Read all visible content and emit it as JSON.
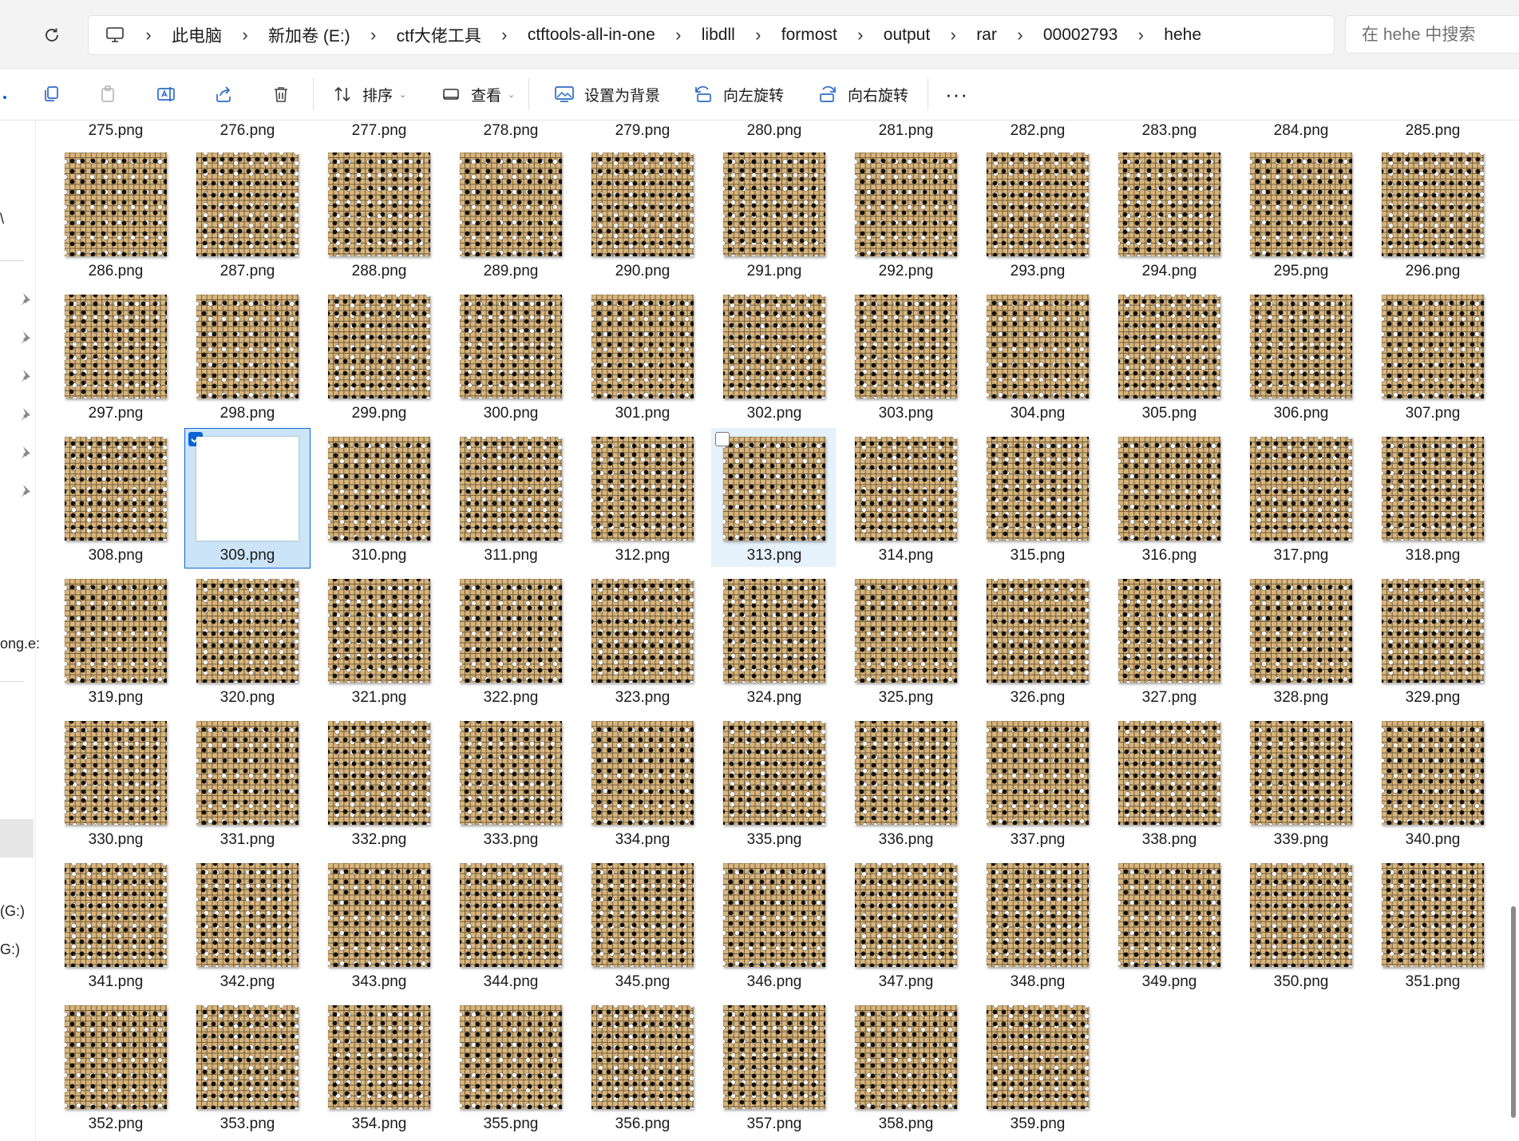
{
  "address": {
    "crumbs": [
      "此电脑",
      "新加卷 (E:)",
      "ctf大佬工具",
      "ctftools-all-in-one",
      "libdll",
      "formost",
      "output",
      "rar",
      "00002793",
      "hehe"
    ],
    "search_placeholder": "在 hehe 中搜索"
  },
  "toolbar": {
    "sort_label": "排序",
    "view_label": "查看",
    "set_background_label": "设置为背景",
    "rotate_left_label": "向左旋转",
    "rotate_right_label": "向右旋转",
    "more_label": "···"
  },
  "nav": {
    "fragments": [
      "\\",
      "ong.e:",
      "(G:)",
      "G:)"
    ]
  },
  "files": {
    "top_row": [
      "275.png",
      "276.png",
      "277.png",
      "278.png",
      "279.png",
      "280.png",
      "281.png",
      "282.png",
      "283.png",
      "284.png",
      "285.png"
    ],
    "grid": [
      "286.png",
      "287.png",
      "288.png",
      "289.png",
      "290.png",
      "291.png",
      "292.png",
      "293.png",
      "294.png",
      "295.png",
      "296.png",
      "297.png",
      "298.png",
      "299.png",
      "300.png",
      "301.png",
      "302.png",
      "303.png",
      "304.png",
      "305.png",
      "306.png",
      "307.png",
      "308.png",
      "309.png",
      "310.png",
      "311.png",
      "312.png",
      "313.png",
      "314.png",
      "315.png",
      "316.png",
      "317.png",
      "318.png",
      "319.png",
      "320.png",
      "321.png",
      "322.png",
      "323.png",
      "324.png",
      "325.png",
      "326.png",
      "327.png",
      "328.png",
      "329.png",
      "330.png",
      "331.png",
      "332.png",
      "333.png",
      "334.png",
      "335.png",
      "336.png",
      "337.png",
      "338.png",
      "339.png",
      "340.png",
      "341.png",
      "342.png",
      "343.png",
      "344.png",
      "345.png",
      "346.png",
      "347.png",
      "348.png",
      "349.png",
      "350.png",
      "351.png",
      "352.png",
      "353.png",
      "354.png",
      "355.png",
      "356.png",
      "357.png",
      "358.png",
      "359.png"
    ],
    "selected": "309.png",
    "hovered": "313.png",
    "blank_thumbnail": "309.png"
  }
}
